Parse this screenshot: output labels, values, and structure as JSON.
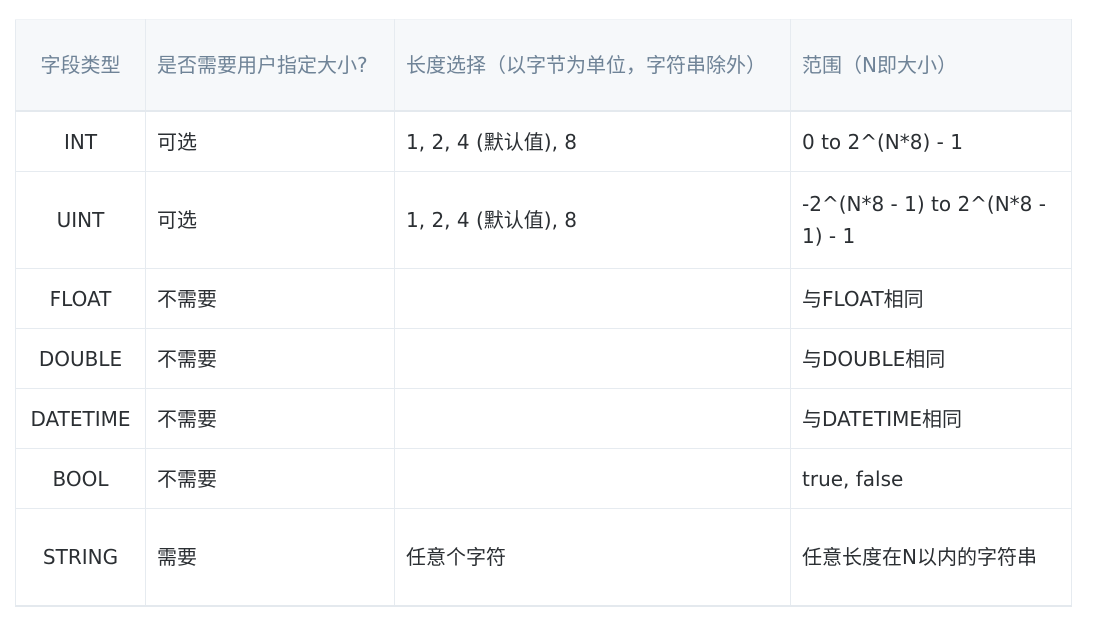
{
  "table": {
    "headers": [
      "字段类型",
      "是否需要用户指定大小?",
      "长度选择（以字节为单位，字符串除外）",
      "范围（N即大小）"
    ],
    "rows": [
      {
        "type": "INT",
        "required": "可选",
        "length": "1, 2, 4 (默认值), 8",
        "range": "0 to 2^(N*8) - 1"
      },
      {
        "type": "UINT",
        "required": "可选",
        "length": "1, 2, 4 (默认值), 8",
        "range": "-2^(N*8 - 1) to 2^(N*8 - 1) - 1"
      },
      {
        "type": "FLOAT",
        "required": "不需要",
        "length": "",
        "range": "与FLOAT相同"
      },
      {
        "type": "DOUBLE",
        "required": "不需要",
        "length": "",
        "range": "与DOUBLE相同"
      },
      {
        "type": "DATETIME",
        "required": "不需要",
        "length": "",
        "range": "与DATETIME相同"
      },
      {
        "type": "BOOL",
        "required": "不需要",
        "length": "",
        "range": "true, false"
      },
      {
        "type": "STRING",
        "required": "需要",
        "length": "任意个字符",
        "range": "任意长度在N以内的字符串"
      }
    ]
  }
}
